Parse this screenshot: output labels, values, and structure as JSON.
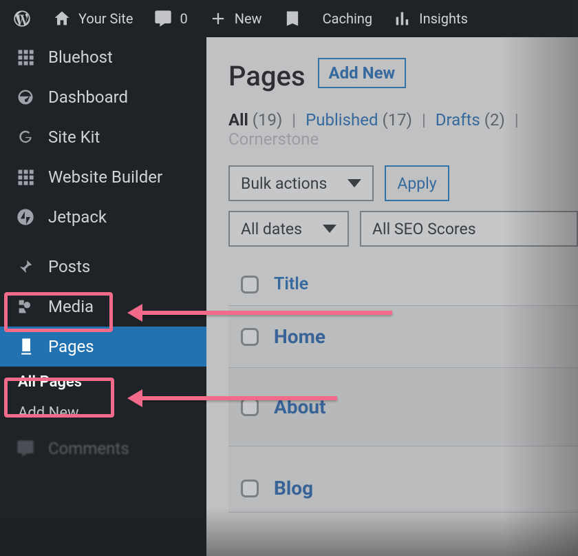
{
  "adminbar": {
    "site_label": "Your Site",
    "comments_count": "0",
    "new_label": "New",
    "caching_label": "Caching",
    "insights_label": "Insights"
  },
  "sidebar": {
    "items": [
      {
        "label": "Bluehost"
      },
      {
        "label": "Dashboard"
      },
      {
        "label": "Site Kit"
      },
      {
        "label": "Website Builder"
      },
      {
        "label": "Jetpack"
      },
      {
        "label": "Posts"
      },
      {
        "label": "Media"
      },
      {
        "label": "Pages"
      },
      {
        "label": "Comments"
      }
    ],
    "subitems": [
      {
        "label": "All Pages"
      },
      {
        "label": "Add New"
      }
    ]
  },
  "main": {
    "title": "Pages",
    "add_new": "Add New",
    "filters": {
      "all_label": "All",
      "all_count": "(19)",
      "published_label": "Published",
      "published_count": "(17)",
      "drafts_label": "Drafts",
      "drafts_count": "(2)",
      "corner_label": "Cornerstone"
    },
    "bulk_actions": "Bulk actions",
    "apply": "Apply",
    "all_dates": "All dates",
    "all_seo": "All SEO Scores",
    "columns": {
      "title": "Title"
    },
    "rows": [
      {
        "title": "Home"
      },
      {
        "title": "About"
      },
      {
        "title": "Blog"
      }
    ]
  }
}
